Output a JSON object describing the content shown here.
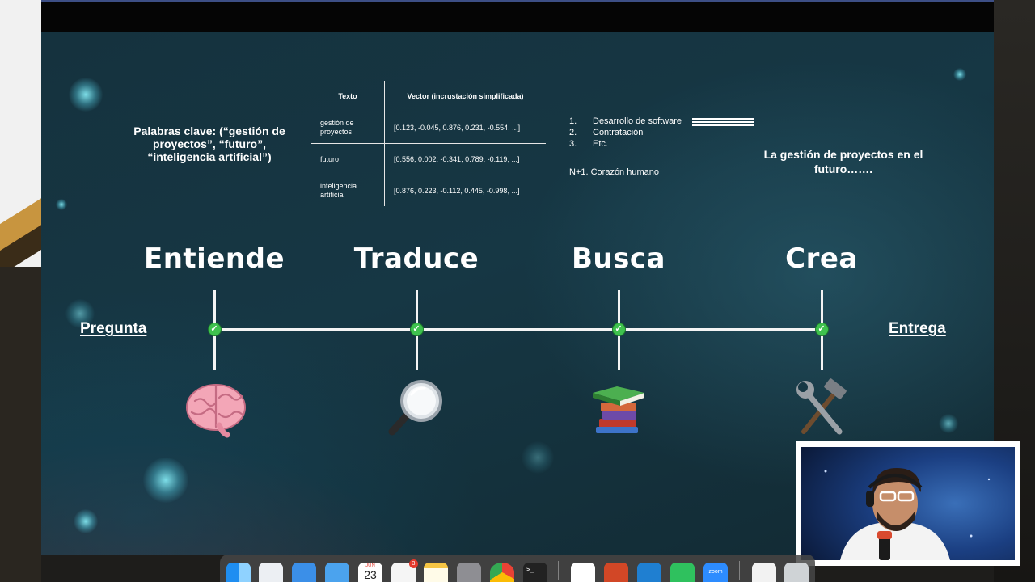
{
  "slide": {
    "keywords": "Palabras clave: (“gestión de proyectos”, “futuro”, “inteligencia artificial”)",
    "table": {
      "headers": [
        "Texto",
        "Vector (incrustación simplificada)"
      ],
      "rows": [
        {
          "text": "gestión de proyectos",
          "vector": "[0.123, -0.045, 0.876, 0.231, -0.554, ...]"
        },
        {
          "text": "futuro",
          "vector": "[0.556, 0.002, -0.341, 0.789, -0.119, ...]"
        },
        {
          "text": "inteligencia artificial",
          "vector": "[0.876, 0.223, -0.112, 0.445, -0.998, ...]"
        }
      ]
    },
    "list": [
      {
        "num": "1.",
        "text": "Desarrollo de software"
      },
      {
        "num": "2.",
        "text": "Contratación"
      },
      {
        "num": "3.",
        "text": "Etc."
      }
    ],
    "list_extra": "N+1. Corazón humano",
    "future_text": "La gestión de proyectos en el futuro…….",
    "timeline": {
      "start_label": "Pregunta",
      "end_label": "Entrega",
      "steps": [
        {
          "title": "Entiende",
          "icon": "brain-icon"
        },
        {
          "title": "Traduce",
          "icon": "magnifying-glass-icon"
        },
        {
          "title": "Busca",
          "icon": "books-icon"
        },
        {
          "title": "Crea",
          "icon": "hammer-wrench-icon"
        }
      ]
    }
  },
  "dock": {
    "apps": [
      "finder-icon",
      "launchpad-icon",
      "safari-icon",
      "mail-icon",
      "calendar-icon",
      "reminders-icon",
      "notes-icon",
      "system-settings-icon",
      "chrome-icon",
      "terminal-icon",
      "chatgpt-icon",
      "powerpoint-icon",
      "vscode-icon",
      "whatsapp-icon",
      "zoom-icon",
      "document-icon",
      "trash-icon"
    ],
    "calendar": {
      "month": "JUN",
      "day": "23"
    },
    "reminders_badge": "3",
    "zoom_label": "zoom",
    "terminal_prompt": ">_"
  },
  "colors": {
    "accent_green": "#3fc14e",
    "slide_bg": "#163744"
  }
}
